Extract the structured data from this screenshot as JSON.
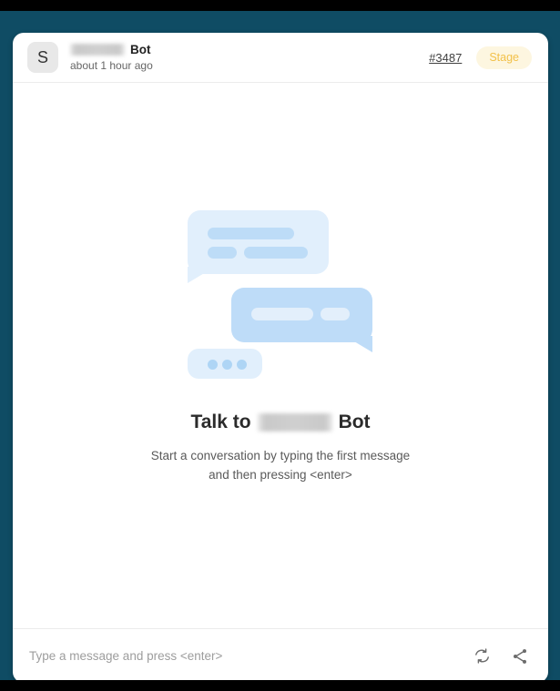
{
  "window": {
    "frame_color": "#0f4c64",
    "backdrop_color": "#000000"
  },
  "header": {
    "avatar_initial": "S",
    "bot_name_redacted": "",
    "bot_name_suffix": "Bot",
    "timestamp": "about 1 hour ago",
    "ticket_link": "#3487",
    "stage_badge": "Stage",
    "stage_badge_text_color": "#f2c14a",
    "stage_badge_bg_color": "#fdf6e0"
  },
  "empty_state": {
    "heading_prefix": "Talk to",
    "heading_redacted": "",
    "heading_suffix": "Bot",
    "subtitle_line_one": "Start a conversation by typing the first message",
    "subtitle_line_two": "and then pressing <enter>",
    "illustration": {
      "bubble_light_color": "#e1effc",
      "bubble_medium_color": "#bedcf8",
      "bar_dark_color": "#bddcf7",
      "bar_light_color": "#e3effb",
      "dot_color": "#aed5f5",
      "dot_count": 3
    }
  },
  "footer": {
    "input_value": "",
    "input_placeholder": "Type a message and press <enter>",
    "refresh_icon": "refresh-icon",
    "share_icon": "share-icon"
  }
}
